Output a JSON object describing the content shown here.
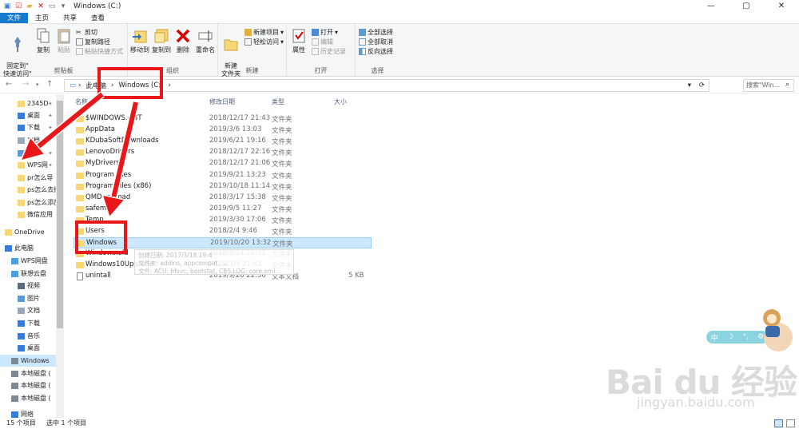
{
  "window": {
    "title": "Windows (C:)",
    "controls": {
      "minimize": "—",
      "maximize": "▢",
      "close": "✕"
    }
  },
  "ribbon_tabs": [
    "文件",
    "主页",
    "共享",
    "查看"
  ],
  "ribbon": {
    "clipboard": {
      "label": "剪贴板",
      "pin": "固定到\"\n快速访问\"",
      "copy": "复制",
      "paste": "粘贴",
      "cut": "剪切",
      "copy_path": "复制路径",
      "paste_shortcut": "粘贴快捷方式"
    },
    "organize": {
      "label": "组织",
      "move_to": "移动到",
      "copy_to": "复制到",
      "delete": "删除",
      "rename": "重命名"
    },
    "new": {
      "label": "新建",
      "new_folder": "新建\n文件夹",
      "new_item": "新建项目",
      "easy_access": "轻松访问"
    },
    "open": {
      "label": "打开",
      "properties": "属性",
      "open": "打开",
      "edit": "编辑",
      "history": "历史记录"
    },
    "select": {
      "label": "选择",
      "select_all": "全部选择",
      "select_none": "全部取消",
      "invert": "反向选择"
    }
  },
  "address": {
    "root": "此电脑",
    "current": "Windows (C:)",
    "search_placeholder": "搜索\"Win..."
  },
  "sidebar": [
    {
      "label": "2345D",
      "icon": "folder",
      "pinned": true
    },
    {
      "label": "桌面",
      "icon": "desktop",
      "pinned": true
    },
    {
      "label": "下载",
      "icon": "download",
      "pinned": true
    },
    {
      "label": "文档",
      "icon": "document",
      "pinned": true
    },
    {
      "label": "图片",
      "icon": "pictures",
      "pinned": true
    },
    {
      "label": "WPS网",
      "icon": "folder",
      "pinned": true
    },
    {
      "label": "pr怎么导",
      "icon": "folder",
      "pinned": false
    },
    {
      "label": "ps怎么去掉",
      "icon": "folder",
      "pinned": false
    },
    {
      "label": "ps怎么添加",
      "icon": "folder",
      "pinned": false
    },
    {
      "label": "微信应用",
      "icon": "folder",
      "pinned": false
    },
    {
      "label": "OneDrive",
      "icon": "onedrive",
      "pinned": false
    },
    {
      "label": "此电脑",
      "icon": "pc",
      "pinned": false
    },
    {
      "label": "WPS网盘",
      "icon": "cloud",
      "pinned": false
    },
    {
      "label": "联想云盘",
      "icon": "cloud",
      "pinned": false
    },
    {
      "label": "视频",
      "icon": "video",
      "pinned": false
    },
    {
      "label": "图片",
      "icon": "pictures",
      "pinned": false
    },
    {
      "label": "文档",
      "icon": "document",
      "pinned": false
    },
    {
      "label": "下载",
      "icon": "download",
      "pinned": false
    },
    {
      "label": "音乐",
      "icon": "music",
      "pinned": false
    },
    {
      "label": "桌面",
      "icon": "desktop",
      "pinned": false
    },
    {
      "label": "Windows",
      "icon": "drive",
      "pinned": false,
      "selected": true
    },
    {
      "label": "本地磁盘 (",
      "icon": "drive",
      "pinned": false
    },
    {
      "label": "本地磁盘 (",
      "icon": "drive",
      "pinned": false
    },
    {
      "label": "本地磁盘 (",
      "icon": "drive",
      "pinned": false
    },
    {
      "label": "网络",
      "icon": "network",
      "pinned": false
    }
  ],
  "columns": {
    "name": "名称",
    "date": "修改日期",
    "type": "类型",
    "size": "大小"
  },
  "files": [
    {
      "name": "$WINDOWS.~BT",
      "date": "2018/12/17 21:43",
      "type": "文件夹",
      "size": ""
    },
    {
      "name": "AppData",
      "date": "2019/3/6 13:03",
      "type": "文件夹",
      "size": ""
    },
    {
      "name": "KDubaSoftDownloads",
      "date": "2019/6/21 19:16",
      "type": "文件夹",
      "size": ""
    },
    {
      "name": "LenovoDrivers",
      "date": "2018/12/17 22:16",
      "type": "文件夹",
      "size": ""
    },
    {
      "name": "MyDrivers",
      "date": "2018/12/17 21:06",
      "type": "文件夹",
      "size": ""
    },
    {
      "name": "Program Files",
      "date": "2019/9/21 13:23",
      "type": "文件夹",
      "size": ""
    },
    {
      "name": "Program Files (x86)",
      "date": "2019/10/18 11:14",
      "type": "文件夹",
      "size": ""
    },
    {
      "name": "QMDownload",
      "date": "2018/3/17 15:38",
      "type": "文件夹",
      "size": ""
    },
    {
      "name": "safemon",
      "date": "2019/9/5 11:27",
      "type": "文件夹",
      "size": ""
    },
    {
      "name": "Temp",
      "date": "2019/3/30 17:06",
      "type": "文件夹",
      "size": ""
    },
    {
      "name": "Users",
      "date": "2018/2/4 9:46",
      "type": "文件夹",
      "size": ""
    },
    {
      "name": "Windows",
      "date": "2019/10/20 13:32",
      "type": "文件夹",
      "size": "",
      "selected": true
    },
    {
      "name": "Windows.old",
      "date": "2018/3/24 18:32",
      "type": "文件夹",
      "size": ""
    },
    {
      "name": "Windows10Upgrade",
      "date": "2019/3/3 21:41",
      "type": "文件夹",
      "size": ""
    },
    {
      "name": "unintall",
      "date": "2019/9/26 22:56",
      "type": "文本文档",
      "size": "5 KB"
    }
  ],
  "tooltip": {
    "line1": "创建日期: 2017/3/18 19:4",
    "line2": "文件夹: addins, appcompat, ...",
    "line3": "文件: ACU, bfsvc, bootstat, CBS.LOG, core.xml..."
  },
  "status": {
    "count": "15 个项目",
    "selected": "选中 1 个项目"
  },
  "widget": {
    "ime": "中"
  },
  "watermark": {
    "brand": "Bai du 经验",
    "url": "jingyan.baidu.com"
  },
  "colors": {
    "accent": "#1979ca",
    "selection": "#cce8ff",
    "annotation": "#e8181a",
    "folder": "#f8d775"
  }
}
